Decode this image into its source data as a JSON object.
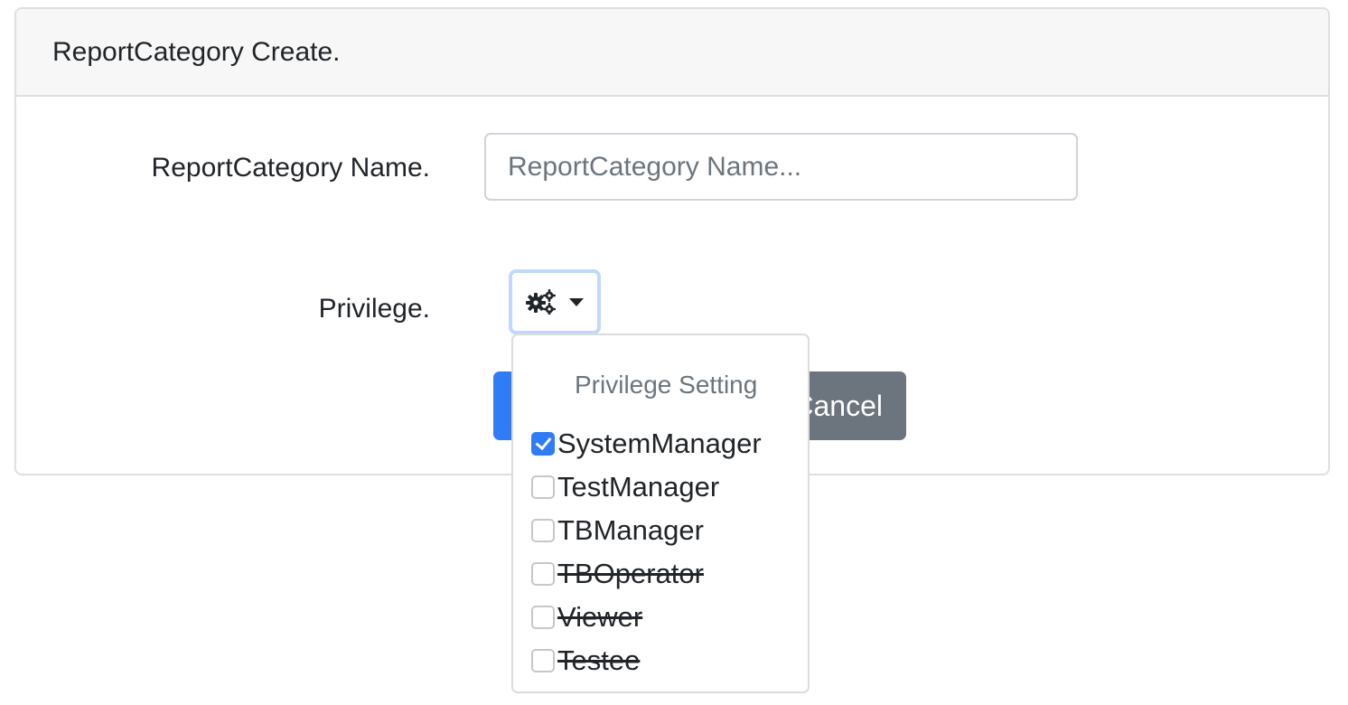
{
  "card": {
    "title": "ReportCategory Create."
  },
  "form": {
    "name_label": "ReportCategory Name.",
    "name_value": "",
    "name_placeholder": "ReportCategory Name...",
    "privilege_label": "Privilege.",
    "privilege_toggle_icon": "gears-icon",
    "cancel_label": "Cancel"
  },
  "privilege_menu": {
    "header": "Privilege Setting",
    "items": [
      {
        "label": "SystemManager",
        "checked": true,
        "struck": false
      },
      {
        "label": "TestManager",
        "checked": false,
        "struck": false
      },
      {
        "label": "TBManager",
        "checked": false,
        "struck": false
      },
      {
        "label": "TBOperator",
        "checked": false,
        "struck": true
      },
      {
        "label": "Viewer",
        "checked": false,
        "struck": true
      },
      {
        "label": "Testee",
        "checked": false,
        "struck": true
      }
    ]
  },
  "colors": {
    "primary": "#2f7cf6",
    "secondary": "#6c757d",
    "focus_ring": "#bfd8fc"
  }
}
